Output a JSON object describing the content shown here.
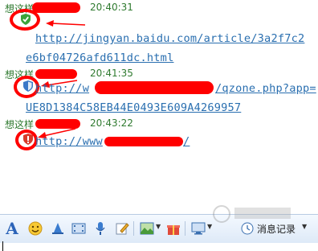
{
  "messages": [
    {
      "sender": "想这样",
      "time": "20:40:31",
      "link_lines": [
        "http://jingyan.baidu.com/article/3a2f7c2",
        "e6bf04726afd611dc.html"
      ],
      "security": "safe"
    },
    {
      "sender": "想这样",
      "time": "20:41:35",
      "link_lines": [
        "http://w",
        "/qzone.php?app=",
        "UE8D1384C58EB44E0493E609A4269957"
      ],
      "security": "unknown"
    },
    {
      "sender": "想这样",
      "time": "20:43:22",
      "link_lines": [
        "http://www",
        "/"
      ],
      "security": "danger"
    }
  ],
  "toolbar": {
    "font_icon": "font-A-icon",
    "history_label": "消息记录"
  },
  "colors": {
    "sender_green": "#2f7a2f",
    "link_blue": "#2a6fb0",
    "annotation_red": "#ff0000",
    "toolbar_top": "#f4f9ff",
    "toolbar_bottom": "#dde9f7"
  }
}
